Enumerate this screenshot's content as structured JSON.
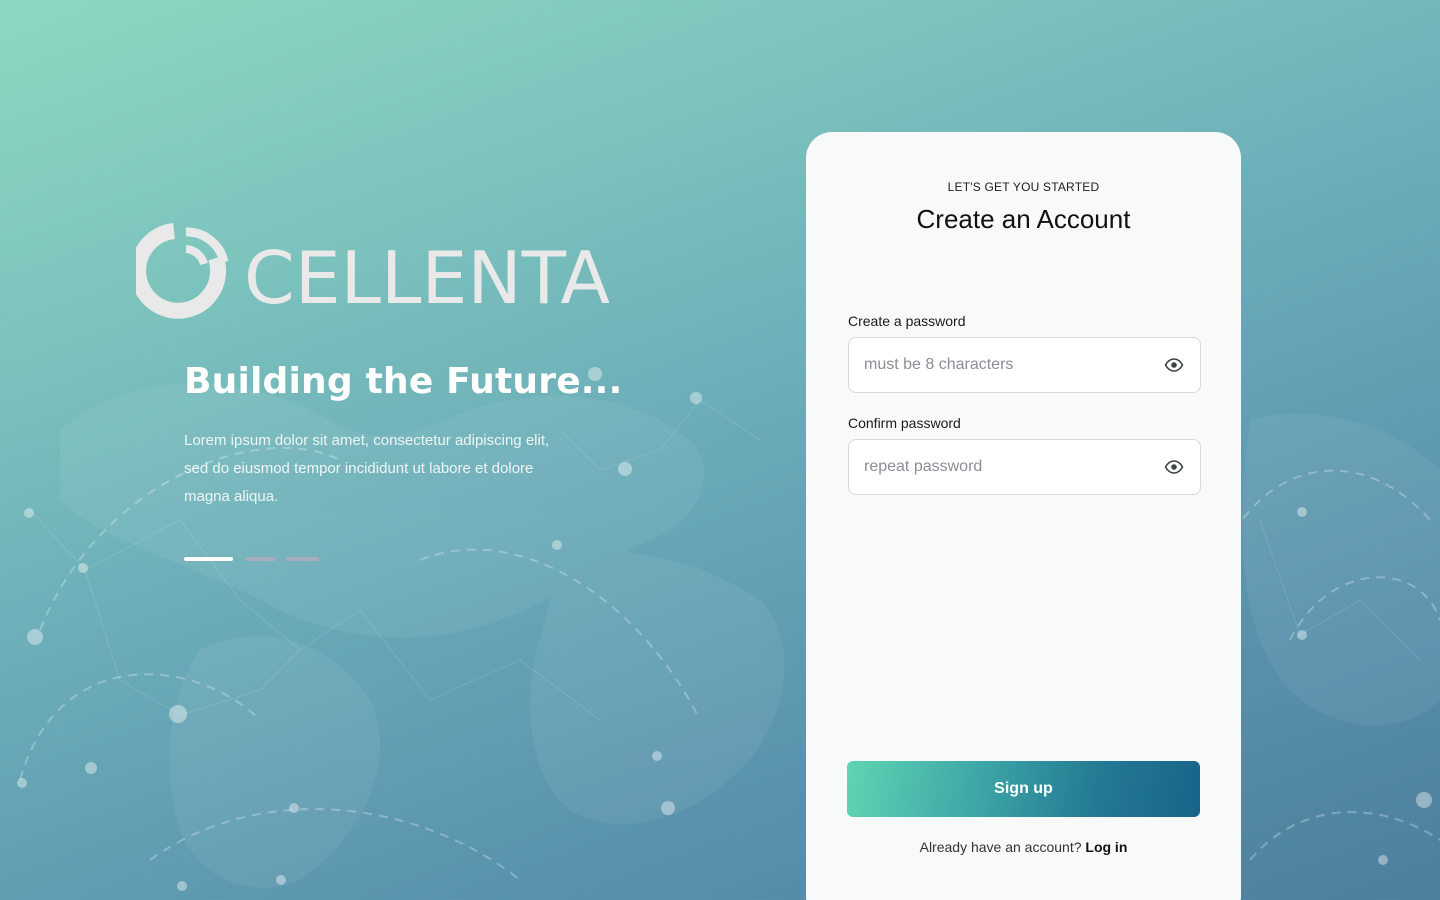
{
  "brand": {
    "name": "CELLENTA",
    "logo_color": "#e9e9e9"
  },
  "hero": {
    "title": "Building the Future...",
    "description": "Lorem ipsum dolor sit amet, consectetur adipiscing elit, sed do eiusmod tempor incididunt ut labore et dolore magna aliqua.",
    "carousel": {
      "slide_count": 3,
      "active_index": 0
    }
  },
  "form": {
    "eyebrow": "LET'S GET YOU STARTED",
    "title": "Create an Account",
    "password": {
      "label": "Create a password",
      "placeholder": "must be 8 characters",
      "value": "",
      "icon": "eye-icon"
    },
    "confirm": {
      "label": "Confirm password",
      "placeholder": "repeat password",
      "value": "",
      "icon": "eye-icon"
    },
    "submit_label": "Sign up",
    "login_prompt": "Already have an account?",
    "login_link": "Log in"
  },
  "colors": {
    "background_start": "#8cd8c1",
    "background_end": "#4c7f9d",
    "card": "#f8f9f9",
    "button_start": "#5fd5b2",
    "button_end": "#17648a"
  }
}
